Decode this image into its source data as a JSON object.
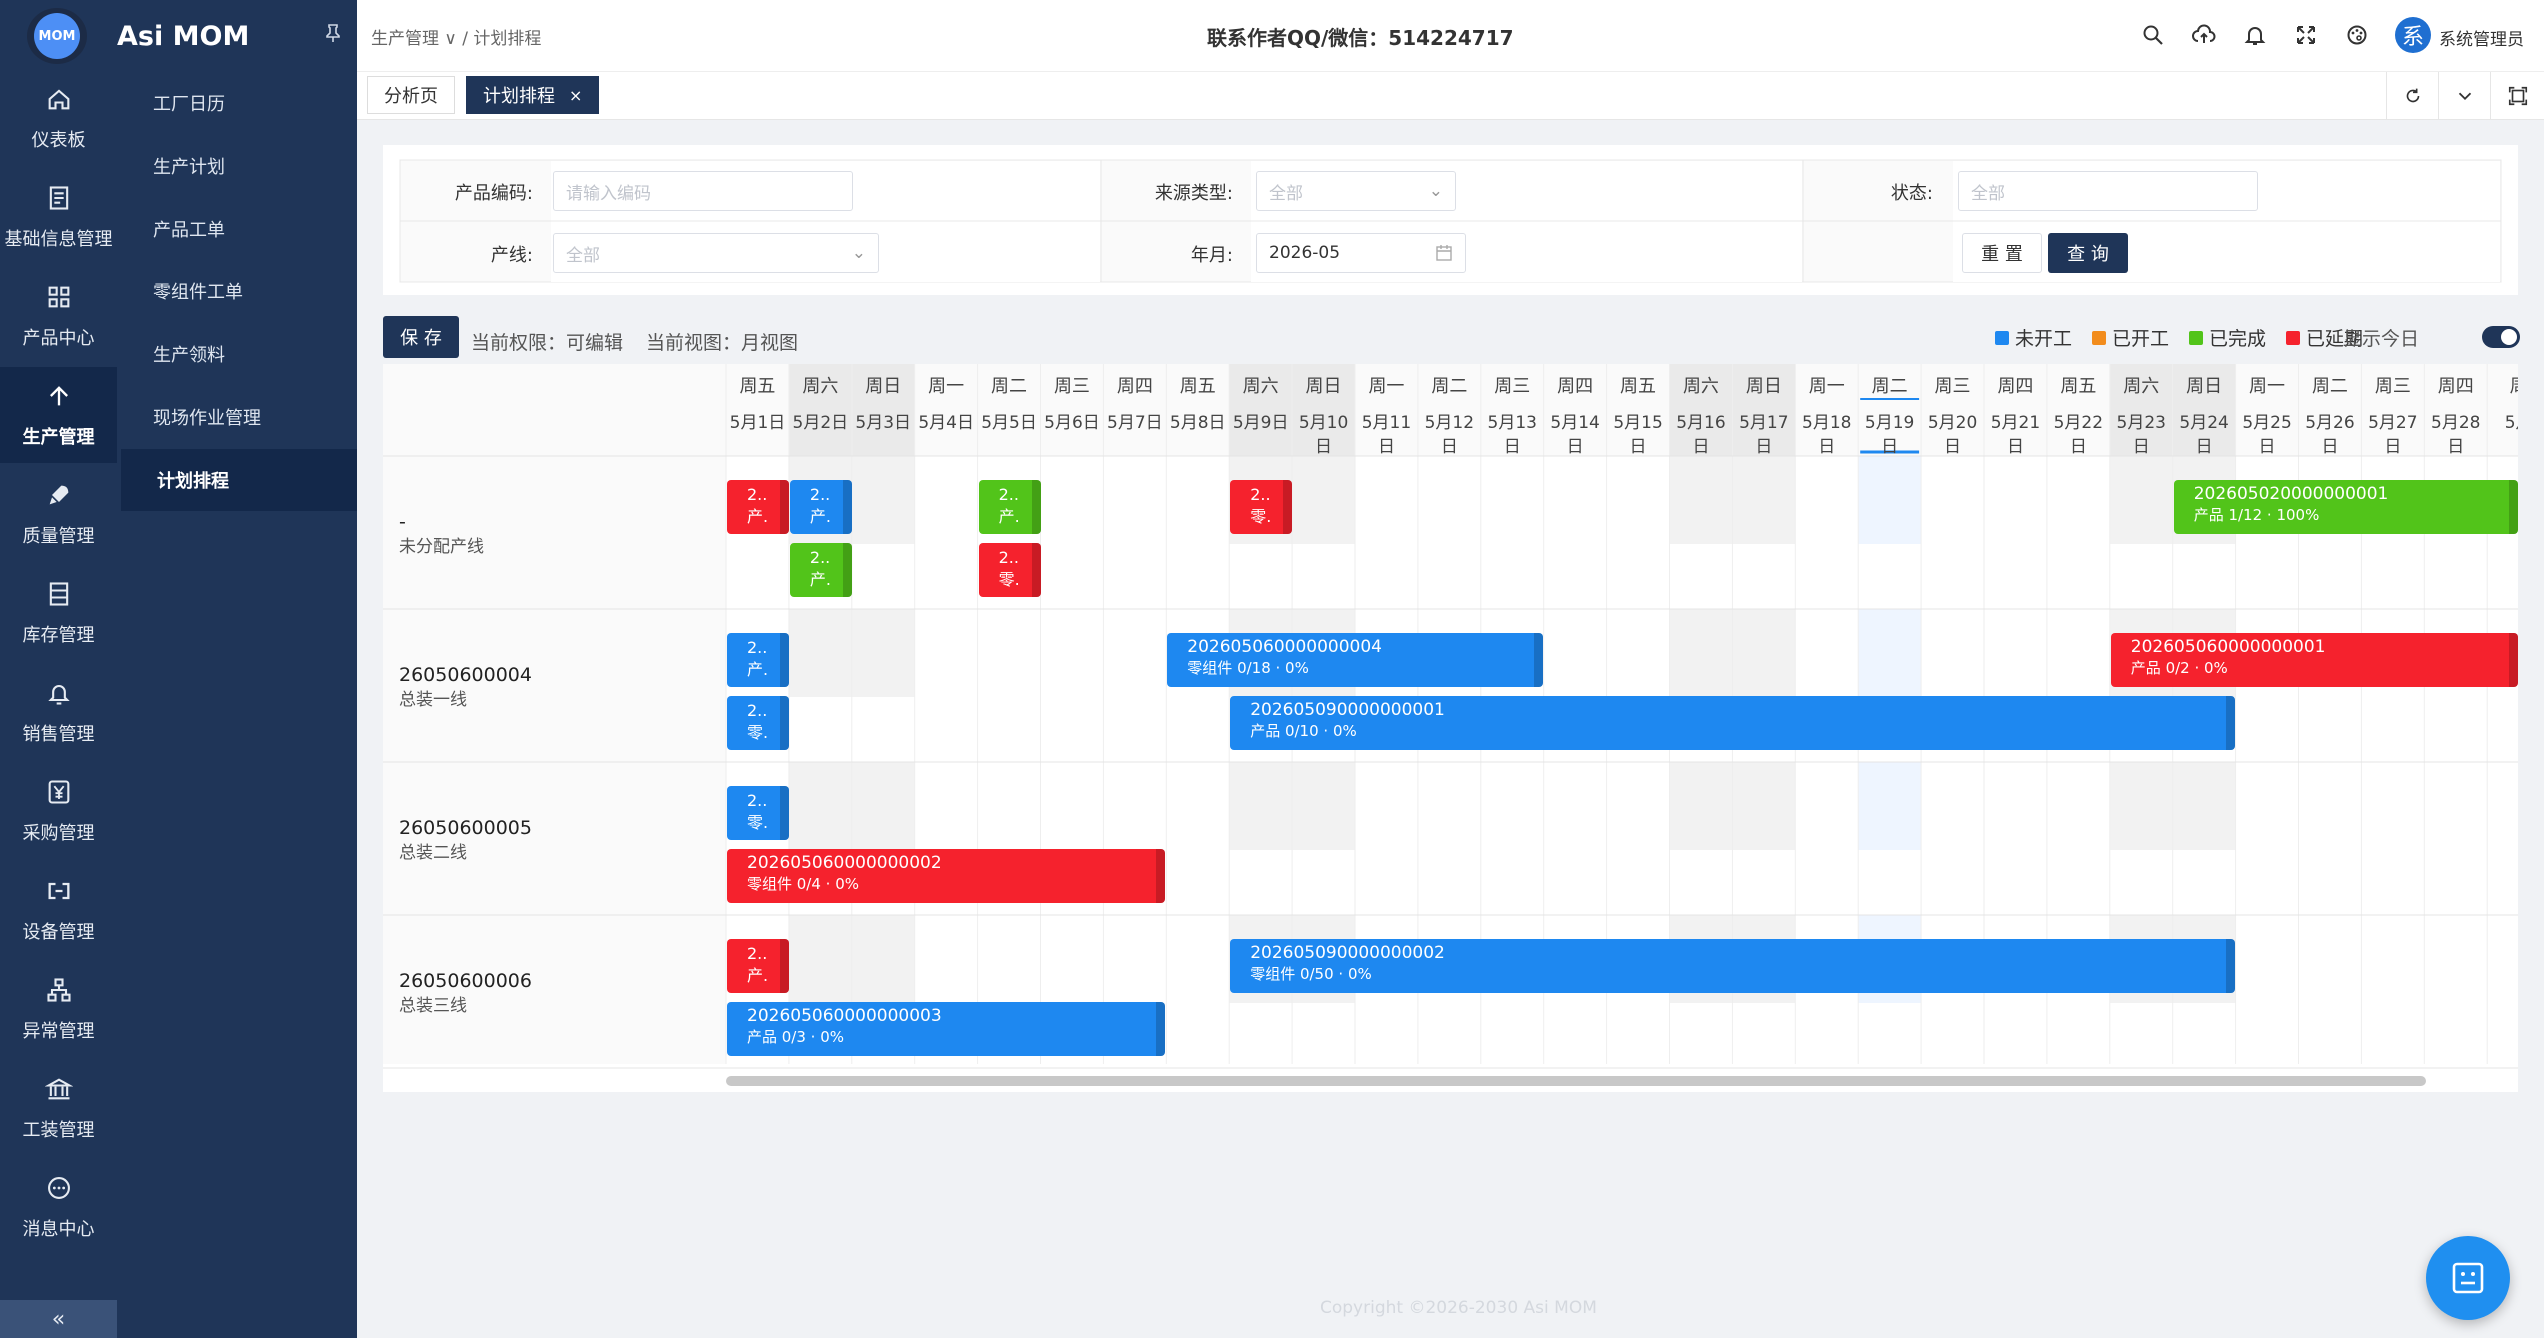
{
  "app": {
    "name": "Asi MOM",
    "logo_text": "MOM"
  },
  "rail": [
    {
      "label": "仪表板",
      "icon": "home-icon"
    },
    {
      "label": "基础信息管理",
      "icon": "document-icon"
    },
    {
      "label": "产品中心",
      "icon": "grid-icon"
    },
    {
      "label": "生产管理",
      "icon": "arrow-up-icon",
      "active": true
    },
    {
      "label": "质量管理",
      "icon": "rocket-icon"
    },
    {
      "label": "库存管理",
      "icon": "inventory-icon"
    },
    {
      "label": "销售管理",
      "icon": "bell-icon"
    },
    {
      "label": "采购管理",
      "icon": "yen-icon"
    },
    {
      "label": "设备管理",
      "icon": "device-icon"
    },
    {
      "label": "异常管理",
      "icon": "network-icon"
    },
    {
      "label": "工装管理",
      "icon": "bank-icon"
    },
    {
      "label": "消息中心",
      "icon": "chat-icon"
    }
  ],
  "submenu": [
    {
      "label": "工厂日历"
    },
    {
      "label": "生产计划"
    },
    {
      "label": "产品工单"
    },
    {
      "label": "零组件工单"
    },
    {
      "label": "生产领料"
    },
    {
      "label": "现场作业管理"
    },
    {
      "label": "计划排程",
      "active": true
    }
  ],
  "header": {
    "crumb_parent": "生产管理",
    "crumb_current": "计划排程",
    "contact": "联系作者QQ/微信：514224717",
    "avatar": "系",
    "user": "系统管理员"
  },
  "tabs": [
    {
      "label": "分析页"
    },
    {
      "label": "计划排程",
      "active": true,
      "close": "×"
    }
  ],
  "filter": {
    "code_label": "产品编码:",
    "code_placeholder": "请输入编码",
    "source_label": "来源类型:",
    "source_value": "全部",
    "status_label": "状态:",
    "status_value": "全部",
    "line_label": "产线:",
    "line_value": "全部",
    "month_label": "年月:",
    "month_value": "2026-05",
    "reset": "重 置",
    "query": "查 询"
  },
  "toolbar": {
    "save": "保 存",
    "perm": "当前权限：可编辑",
    "view": "当前视图：月视图",
    "show_today": "显示今日"
  },
  "legend": [
    {
      "label": "未开工",
      "color": "#1e88f0"
    },
    {
      "label": "已开工",
      "color": "#f28c1c"
    },
    {
      "label": "已完成",
      "color": "#52c41a"
    },
    {
      "label": "已延期",
      "color": "#f5222d"
    }
  ],
  "colors": {
    "blue": "#1e88f0",
    "green": "#52c41a",
    "red": "#f5222d",
    "nav": "#1f3558"
  },
  "weekdays": [
    "周五",
    "周六",
    "周日",
    "周一",
    "周二",
    "周三",
    "周四",
    "周五",
    "周六",
    "周日",
    "周一",
    "周二",
    "周三",
    "周四",
    "周五",
    "周六",
    "周日",
    "周一",
    "周二",
    "周三",
    "周四",
    "周五",
    "周六",
    "周日",
    "周一",
    "周二",
    "周三",
    "周四",
    "周"
  ],
  "dates": [
    "5月1日",
    "5月2日",
    "5月3日",
    "5月4日",
    "5月5日",
    "5月6日",
    "5月7日",
    "5月8日",
    "5月9日",
    "5月10",
    "5月11",
    "5月12",
    "5月13",
    "5月14",
    "5月15",
    "5月16",
    "5月17",
    "5月18",
    "5月19",
    "5月20",
    "5月21",
    "5月22",
    "5月23",
    "5月24",
    "5月25",
    "5月26",
    "5月27",
    "5月28",
    "5月"
  ],
  "date_suffix": "日",
  "rows": [
    {
      "code": "-",
      "line": "未分配产线"
    },
    {
      "code": "26050600004",
      "line": "总装一线"
    },
    {
      "code": "26050600005",
      "line": "总装二线"
    },
    {
      "code": "26050600006",
      "line": "总装三线"
    }
  ],
  "chart_data": {
    "type": "gantt",
    "month": "2026-05",
    "today": 19,
    "tasks": [
      {
        "row": 0,
        "lane": 0,
        "start": 1,
        "end": 1,
        "status": "已延期",
        "l1": "2..",
        "l2": "产."
      },
      {
        "row": 0,
        "lane": 0,
        "start": 2,
        "end": 2,
        "status": "未开工",
        "l1": "2..",
        "l2": "产."
      },
      {
        "row": 0,
        "lane": 0,
        "start": 5,
        "end": 5,
        "status": "已完成",
        "l1": "2..",
        "l2": "产."
      },
      {
        "row": 0,
        "lane": 0,
        "start": 9,
        "end": 9,
        "status": "已延期",
        "l1": "2..",
        "l2": "零."
      },
      {
        "row": 0,
        "lane": 0,
        "start": 24,
        "end": 30,
        "status": "已完成",
        "l1": "202605020000000001",
        "l2": "产品 1/12 · 100%"
      },
      {
        "row": 0,
        "lane": 1,
        "start": 2,
        "end": 2,
        "status": "已完成",
        "l1": "2..",
        "l2": "产."
      },
      {
        "row": 0,
        "lane": 1,
        "start": 5,
        "end": 5,
        "status": "已延期",
        "l1": "2..",
        "l2": "零."
      },
      {
        "row": 1,
        "lane": 0,
        "start": 1,
        "end": 1,
        "status": "未开工",
        "l1": "2..",
        "l2": "产."
      },
      {
        "row": 1,
        "lane": 0,
        "start": 8,
        "end": 13,
        "status": "未开工",
        "l1": "202605060000000004",
        "l2": "零组件 0/18 · 0%"
      },
      {
        "row": 1,
        "lane": 0,
        "start": 23,
        "end": 30,
        "status": "已延期",
        "l1": "202605060000000001",
        "l2": "产品 0/2 · 0%"
      },
      {
        "row": 1,
        "lane": 1,
        "start": 1,
        "end": 1,
        "status": "未开工",
        "l1": "2..",
        "l2": "零."
      },
      {
        "row": 1,
        "lane": 1,
        "start": 9,
        "end": 24,
        "status": "未开工",
        "l1": "202605090000000001",
        "l2": "产品 0/10 · 0%"
      },
      {
        "row": 2,
        "lane": 0,
        "start": 1,
        "end": 1,
        "status": "未开工",
        "l1": "2..",
        "l2": "零."
      },
      {
        "row": 2,
        "lane": 1,
        "start": 1,
        "end": 7,
        "status": "已延期",
        "l1": "202605060000000002",
        "l2": "零组件 0/4 · 0%"
      },
      {
        "row": 3,
        "lane": 0,
        "start": 1,
        "end": 1,
        "status": "已延期",
        "l1": "2..",
        "l2": "产."
      },
      {
        "row": 3,
        "lane": 0,
        "start": 9,
        "end": 24,
        "status": "未开工",
        "l1": "202605090000000002",
        "l2": "零组件 0/50 · 0%"
      },
      {
        "row": 3,
        "lane": 1,
        "start": 1,
        "end": 7,
        "status": "未开工",
        "l1": "202605060000000003",
        "l2": "产品 0/3 · 0%"
      }
    ]
  },
  "footer": "Copyright ©2026-2030 Asi MOM"
}
